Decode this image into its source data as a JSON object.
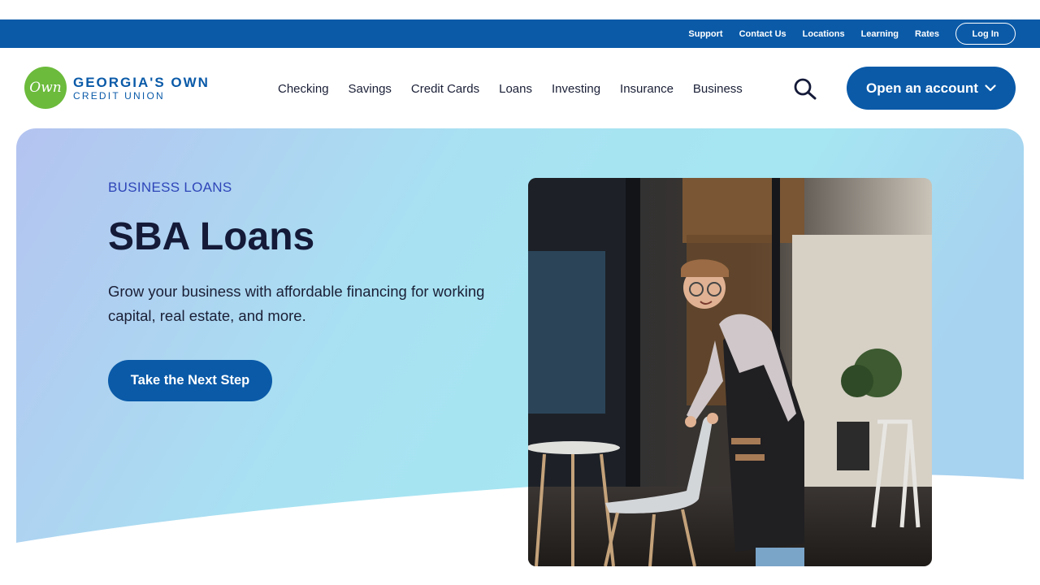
{
  "utility_nav": {
    "links": [
      "Support",
      "Contact Us",
      "Locations",
      "Learning",
      "Rates"
    ],
    "login_label": "Log In"
  },
  "logo": {
    "mark_text": "Own",
    "line1": "GEORGIA'S OWN",
    "line2": "CREDIT UNION"
  },
  "main_nav": {
    "items": [
      "Checking",
      "Savings",
      "Credit Cards",
      "Loans",
      "Investing",
      "Insurance",
      "Business"
    ],
    "search_icon": "search-icon",
    "open_account_label": "Open an account"
  },
  "hero": {
    "eyebrow": "BUSINESS LOANS",
    "title": "SBA Loans",
    "description": "Grow your business with affordable financing for working capital, real estate, and more.",
    "cta_label": "Take the Next Step"
  },
  "colors": {
    "brand_blue": "#0a5aa8",
    "logo_green": "#6cbb3c",
    "eyebrow_blue": "#2e46b8"
  }
}
